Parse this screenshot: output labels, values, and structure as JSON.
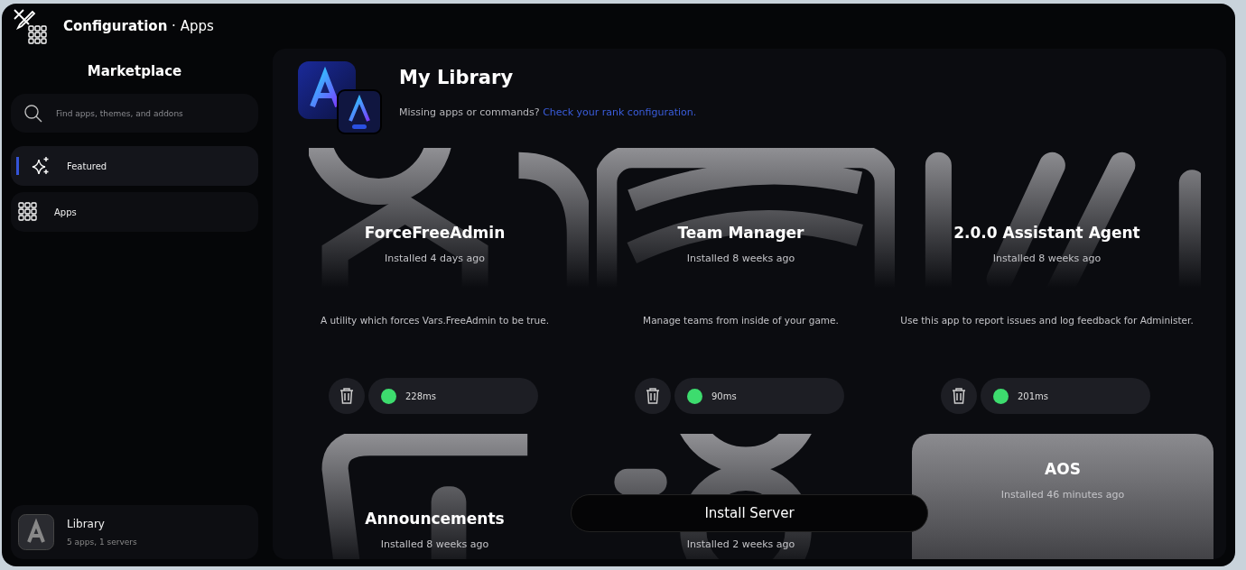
{
  "window": {
    "title": "**Configuration** · Apps"
  },
  "sidebar": {
    "title": "Marketplace",
    "search": {
      "placeholder": "Find apps, themes, and addons"
    },
    "items": [
      {
        "label": "Featured",
        "selected": true
      },
      {
        "label": "Apps",
        "selected": false
      }
    ],
    "library": {
      "title": "Library",
      "subtitle": "5 apps, 1 servers"
    }
  },
  "main": {
    "title": "My Library",
    "subtitle": "Missing apps or commands?",
    "link": "Check your rank configuration.",
    "apps": [
      {
        "kind": "art",
        "name": "ForceFreeAdmin",
        "installed": "Installed 4 days ago",
        "description": "A utility which forces Vars.FreeAdmin to be true.",
        "ping": "228ms",
        "color": "#3ddc6e"
      },
      {
        "kind": "art",
        "name": "Team Manager",
        "installed": "Installed 8 weeks ago",
        "description": "Manage teams from inside of your game.",
        "ping": "90ms",
        "color": "#3ddc6e"
      },
      {
        "kind": "art",
        "name": "2.0.0 Assistant Agent",
        "installed": "Installed 8 weeks ago",
        "description": "Use this app to report issues and log feedback for Administer.",
        "ping": "201ms",
        "color": "#3ddc6e"
      },
      {
        "kind": "art",
        "name": "Announcements",
        "installed": "Installed 8 weeks ago"
      },
      {
        "kind": "art",
        "installed": "Installed 2 weeks ago"
      },
      {
        "kind": "plain",
        "name": "AOS",
        "installed": "Installed 46 minutes ago"
      }
    ],
    "install_button": "Install Server"
  }
}
